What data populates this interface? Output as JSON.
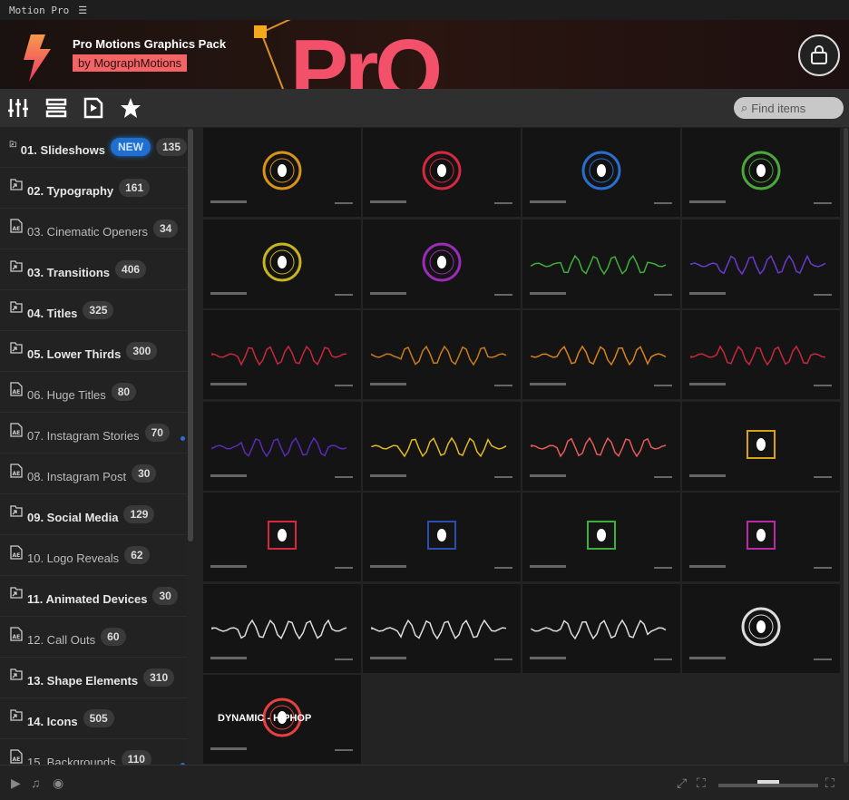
{
  "app": {
    "title": "Motion Pro",
    "menu_icon": "hamburger-icon"
  },
  "banner": {
    "title": "Pro Motions Graphics Pack",
    "author": "by MographMotions",
    "art_text": "PrO",
    "brand_color": "#f26466"
  },
  "toolbar": {
    "icons": [
      "sliders-icon",
      "list-icon",
      "play-file-icon",
      "star-icon"
    ],
    "search_placeholder": "Find items"
  },
  "sidebar": {
    "items": [
      {
        "label": "01. Slideshows",
        "count": "135",
        "badge": "NEW",
        "type": "folder"
      },
      {
        "label": "02. Typography",
        "count": "161",
        "type": "folder"
      },
      {
        "label": "03. Cinematic Openers",
        "count": "34",
        "type": "ae"
      },
      {
        "label": "03. Transitions",
        "count": "406",
        "type": "folder"
      },
      {
        "label": "04. Titles",
        "count": "325",
        "type": "folder"
      },
      {
        "label": "05. Lower Thirds",
        "count": "300",
        "type": "folder"
      },
      {
        "label": "06. Huge Titles",
        "count": "80",
        "type": "ae"
      },
      {
        "label": "07. Instagram Stories",
        "count": "70",
        "type": "ae",
        "dot": true
      },
      {
        "label": "08. Instagram Post",
        "count": "30",
        "type": "ae"
      },
      {
        "label": "09. Social Media",
        "count": "129",
        "type": "folder"
      },
      {
        "label": "10. Logo Reveals",
        "count": "62",
        "type": "ae"
      },
      {
        "label": "11. Animated Devices",
        "count": "30",
        "type": "folder"
      },
      {
        "label": "12. Call Outs",
        "count": "60",
        "type": "ae"
      },
      {
        "label": "13. Shape Elements",
        "count": "310",
        "type": "folder"
      },
      {
        "label": "14. Icons",
        "count": "505",
        "type": "folder"
      },
      {
        "label": "15. Backgrounds",
        "count": "110",
        "type": "ae",
        "dot": true
      }
    ]
  },
  "grid": {
    "thumbnails": [
      {
        "style": "ring",
        "color": "#d9921a"
      },
      {
        "style": "ring",
        "color": "#d6283e"
      },
      {
        "style": "ring",
        "color": "#2a6fd0"
      },
      {
        "style": "ring",
        "color": "#4ca83a"
      },
      {
        "style": "ring",
        "color": "#c8b41e"
      },
      {
        "style": "ring",
        "color": "#9b2bb8"
      },
      {
        "style": "wave",
        "color": "#3fae3a"
      },
      {
        "style": "wave",
        "color": "#6a3ad0"
      },
      {
        "style": "wave",
        "color": "#c8283a"
      },
      {
        "style": "wave",
        "color": "#c87a1e"
      },
      {
        "style": "wave",
        "color": "#d9821a"
      },
      {
        "style": "wave",
        "color": "#c8283a"
      },
      {
        "style": "wave",
        "color": "#5a2ab8"
      },
      {
        "style": "wave",
        "color": "#e3b81e"
      },
      {
        "style": "wave",
        "color": "#e85a5a"
      },
      {
        "style": "square",
        "color": "#d9a01a"
      },
      {
        "style": "square",
        "color": "#d6283e"
      },
      {
        "style": "square",
        "color": "#2a4fb0"
      },
      {
        "style": "square",
        "color": "#3fae3a"
      },
      {
        "style": "square",
        "color": "#b82aa8"
      },
      {
        "style": "wave",
        "color": "#dddddd"
      },
      {
        "style": "wave",
        "color": "#dddddd"
      },
      {
        "style": "wave",
        "color": "#dddddd"
      },
      {
        "style": "ring",
        "color": "#dddddd"
      },
      {
        "style": "ring",
        "color": "#e84040"
      }
    ],
    "big_caption": "DYNAMIC - HIPHOP"
  },
  "bottom": {
    "icons": [
      "video-icon",
      "music-icon",
      "toggle-icon",
      "fit-icon",
      "fullscreen-icon",
      "expand-icon"
    ],
    "thumb_size_percent": 50
  }
}
